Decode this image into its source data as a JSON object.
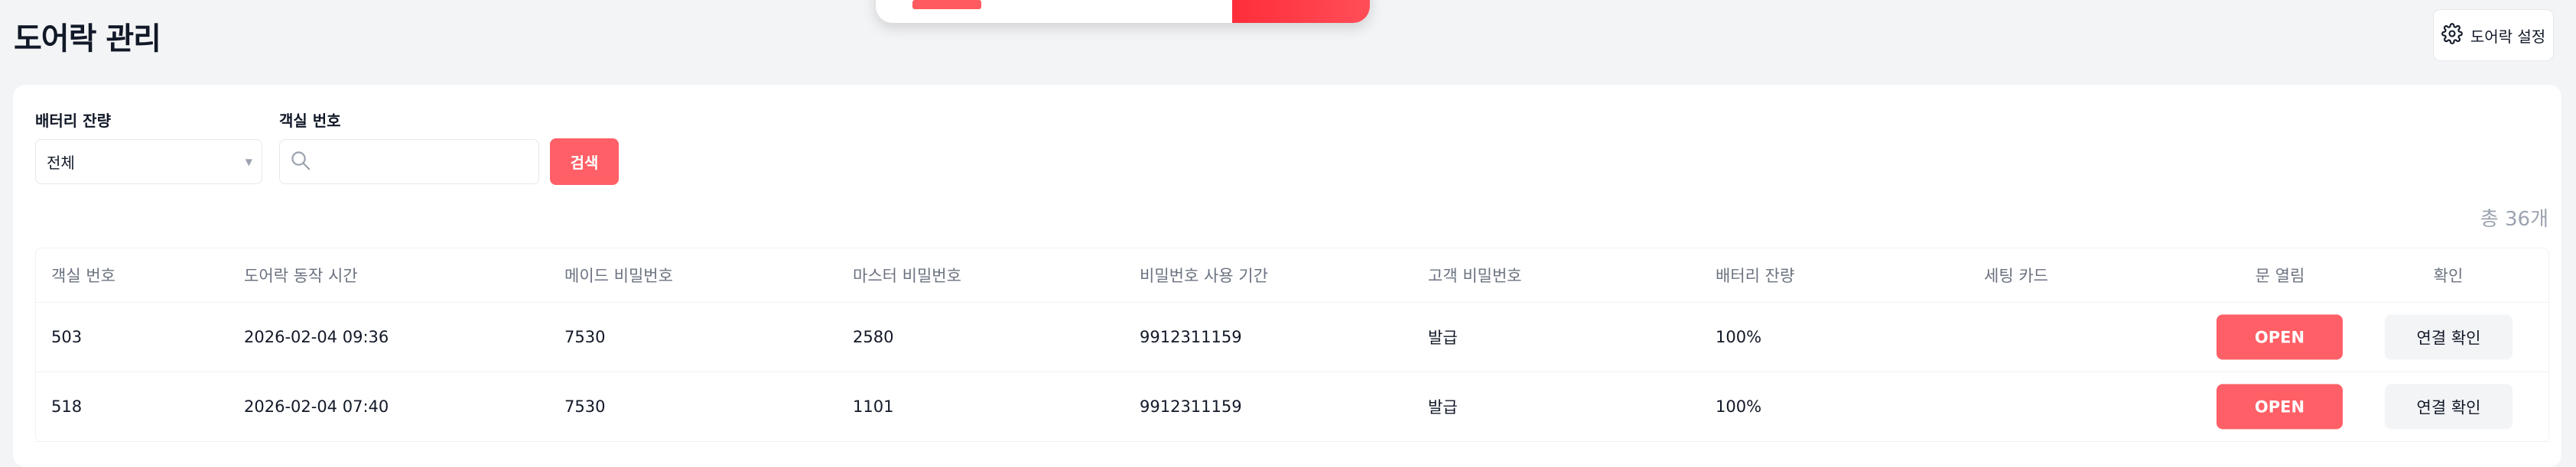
{
  "page": {
    "title": "도어락 관리",
    "settings_label": "도어락 설정"
  },
  "filters": {
    "battery_label": "배터리 잔량",
    "battery_value": "전체",
    "room_label": "객실 번호",
    "room_value": "",
    "search_label": "검색"
  },
  "total_text": "총 36개",
  "table": {
    "headers": {
      "room": "객실 번호",
      "time": "도어락 동작 시간",
      "maid": "메이드 비밀번호",
      "master": "마스터 비밀번호",
      "period": "비밀번호 사용 기간",
      "guest": "고객 비밀번호",
      "battery": "배터리 잔량",
      "card": "세팅 카드",
      "door": "문 열림",
      "check": "확인"
    },
    "rows": [
      {
        "room": "503",
        "time": "2026-02-04 09:36",
        "maid": "7530",
        "master": "2580",
        "period": "9912311159",
        "guest": "발급",
        "battery": "100%",
        "card": "",
        "open": "OPEN",
        "check": "연결 확인"
      },
      {
        "room": "518",
        "time": "2026-02-04 07:40",
        "maid": "7530",
        "master": "1101",
        "period": "9912311159",
        "guest": "발급",
        "battery": "100%",
        "card": "",
        "open": "OPEN",
        "check": "연결 확인"
      }
    ]
  },
  "icons": {
    "settings": "gear-icon",
    "search": "search-icon",
    "select": "chevron-down-icon"
  },
  "colors": {
    "accent": "#ff5f66",
    "background": "#f3f4f6"
  }
}
